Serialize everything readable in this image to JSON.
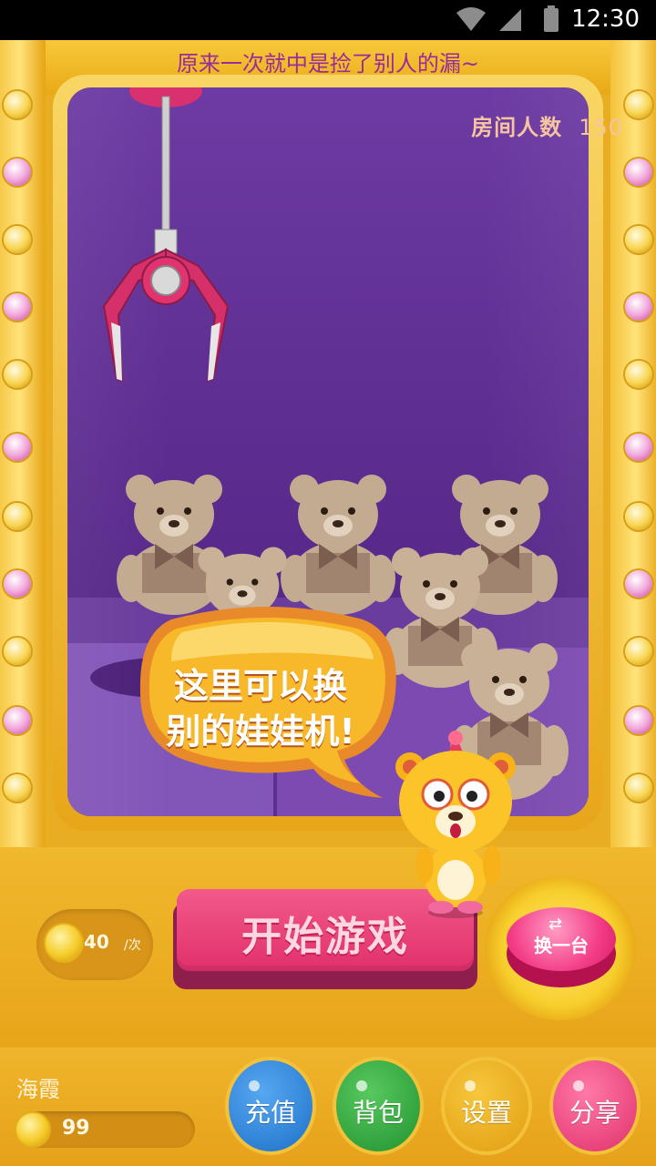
{
  "status_bar": {
    "time": "12:30"
  },
  "marquee": {
    "text": "原来一次就中是捡了别人的漏~"
  },
  "room": {
    "label": "房间人数",
    "count": "150"
  },
  "play": {
    "cost": "40",
    "cost_unit": "/次",
    "start_label": "开始游戏",
    "switch_label": "换一台"
  },
  "tutorial": {
    "line1": "这里可以换",
    "line2": "别的娃娃机!"
  },
  "user": {
    "name": "海霞",
    "coins": "99"
  },
  "bottom_nav": {
    "recharge": "充值",
    "bag": "背包",
    "settings": "设置",
    "share": "分享"
  },
  "colors": {
    "cabinet": "#e9ad24",
    "glass": "#5b2b8e",
    "start_button": "#e1306c",
    "recharge": "#1e70c9",
    "bag": "#23922f",
    "settings": "#e19d12",
    "share": "#e1306c"
  }
}
